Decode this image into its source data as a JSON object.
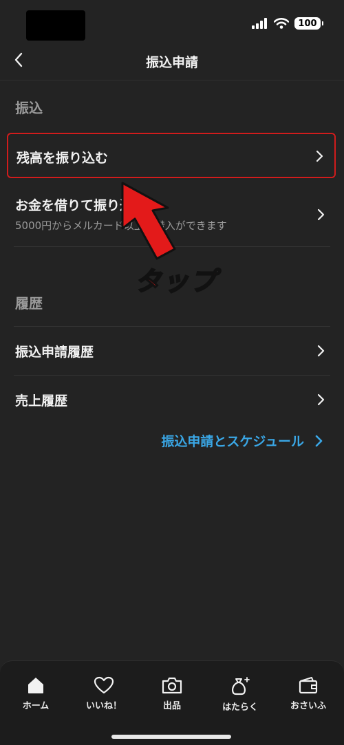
{
  "status_bar": {
    "battery": "100"
  },
  "header": {
    "title": "振込申請"
  },
  "section_transfer": {
    "title": "振込",
    "items": [
      {
        "label": "残高を振り込む"
      },
      {
        "label": "お金を借りて振り込む",
        "sub": "5000円からメルカード以上で借入ができます"
      }
    ]
  },
  "annotation": {
    "tap_text": "タップ",
    "highlight_color": "#d11c1c",
    "arrow_color": "#e31a1a"
  },
  "section_history": {
    "title": "履歴",
    "items": [
      {
        "label": "振込申請履歴"
      },
      {
        "label": "売上履歴"
      }
    ]
  },
  "schedule_link": {
    "label": "振込申請とスケジュール",
    "color": "#3aa7e6"
  },
  "tabbar": {
    "tabs": [
      {
        "label": "ホーム",
        "icon": "home-icon"
      },
      {
        "label": "いいね！",
        "icon": "heart-icon"
      },
      {
        "label": "出品",
        "icon": "camera-icon"
      },
      {
        "label": "はたらく",
        "icon": "money-bag-icon"
      },
      {
        "label": "おさいふ",
        "icon": "wallet-icon"
      }
    ]
  }
}
